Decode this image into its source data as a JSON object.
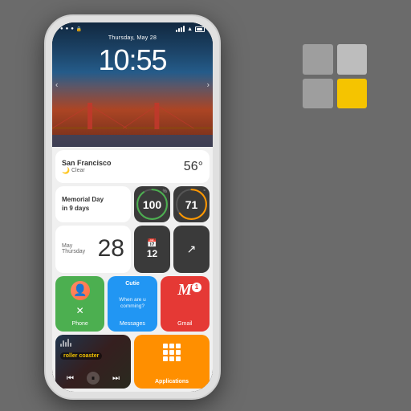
{
  "background_color": "#6b6b6b",
  "logo": {
    "cells": [
      "gray-top-left",
      "gray-top-right",
      "gray-bottom-left",
      "yellow-bottom-right"
    ],
    "accent_color": "#f5c400"
  },
  "phone": {
    "status_bar": {
      "left_icons": [
        "dot",
        "dot",
        "dot",
        "dot"
      ],
      "date": "Thursday, May 28",
      "right": "signal wifi battery"
    },
    "time": "10:55",
    "location": "San Francisco",
    "condition": "Clear",
    "temperature": "56°",
    "memorial": {
      "line1": "Memorial Day",
      "line2": "in 9 days"
    },
    "battery_level": "100",
    "steps": "71",
    "month": "May",
    "weekday": "Thursday",
    "date_num": "28",
    "phone_app": {
      "label": "Phone",
      "has_avatar": true
    },
    "messages_app": {
      "label": "Messages",
      "sender": "Cutie",
      "preview": "When are u comming?"
    },
    "gmail_app": {
      "label": "Gmail",
      "badge": "1"
    },
    "music": {
      "track": "roller coaster",
      "controls": [
        "prev",
        "pause",
        "next"
      ]
    },
    "applications": {
      "label": "Applications"
    }
  }
}
